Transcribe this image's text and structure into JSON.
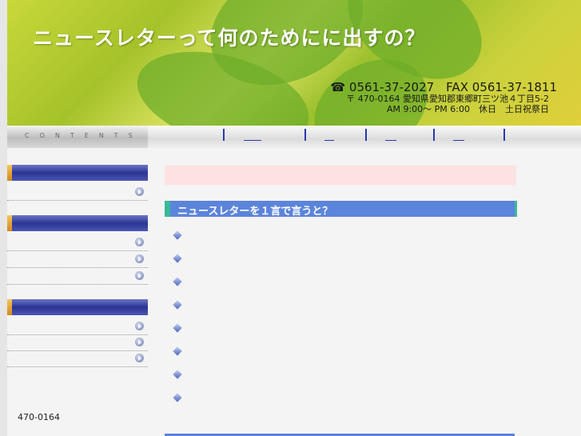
{
  "header": {
    "title": "ニュースレターって何のためにに出すの？",
    "phone": "☎ 0561-37-2027　FAX 0561-37-1811",
    "address": "〒 470-0164 愛知県愛知郡東郷町三ツ池４丁目5-2",
    "hours": "AM 9:00～ PM 6:00　休日　土日祝祭日"
  },
  "nav": {
    "contents_label": "CONTENTS",
    "link_count": 4
  },
  "sidebar": {
    "postal": "470-0164"
  },
  "main": {
    "section_title": "ニュースレターを１言で言うと？",
    "bullet_count": 8
  },
  "colors": {
    "section_header": "#5b84db",
    "sidebar_header": "#2b3592",
    "pink_box": "#fde2e2",
    "accent_teal": "#3ab89a"
  }
}
